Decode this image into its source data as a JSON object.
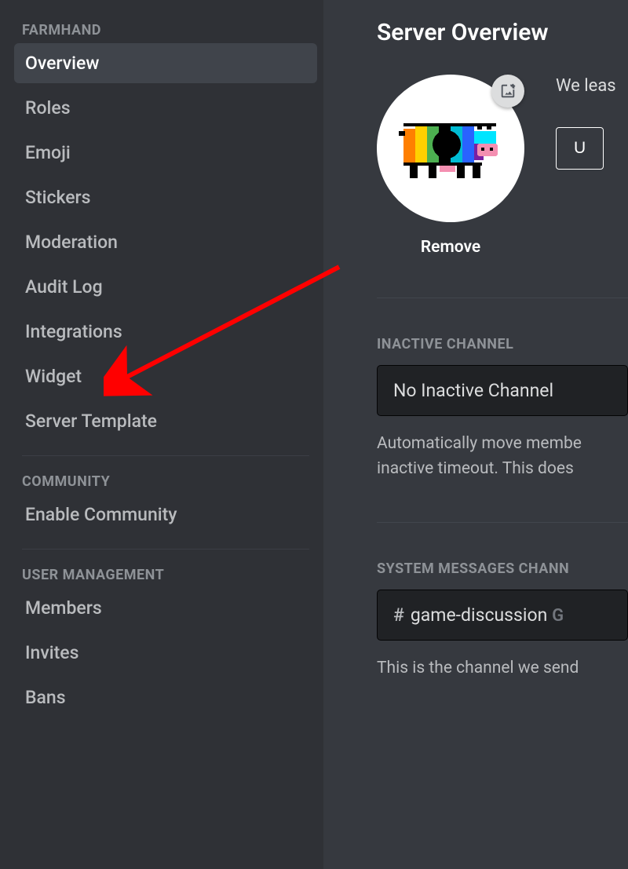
{
  "sidebar": {
    "sections": [
      {
        "header": "FARMHAND",
        "items": [
          {
            "label": "Overview",
            "selected": true
          },
          {
            "label": "Roles",
            "selected": false
          },
          {
            "label": "Emoji",
            "selected": false
          },
          {
            "label": "Stickers",
            "selected": false
          },
          {
            "label": "Moderation",
            "selected": false
          },
          {
            "label": "Audit Log",
            "selected": false
          },
          {
            "label": "Integrations",
            "selected": false
          },
          {
            "label": "Widget",
            "selected": false
          },
          {
            "label": "Server Template",
            "selected": false
          }
        ]
      },
      {
        "header": "COMMUNITY",
        "items": [
          {
            "label": "Enable Community",
            "selected": false
          }
        ]
      },
      {
        "header": "USER MANAGEMENT",
        "items": [
          {
            "label": "Members",
            "selected": false
          },
          {
            "label": "Invites",
            "selected": false
          },
          {
            "label": "Bans",
            "selected": false
          }
        ]
      }
    ]
  },
  "main": {
    "title": "Server Overview",
    "avatar": {
      "remove_label": "Remove",
      "hint": "We leas",
      "upload_button": "U"
    },
    "inactive": {
      "label": "INACTIVE CHANNEL",
      "value": "No Inactive Channel",
      "helper": "Automatically move membe inactive timeout. This does"
    },
    "system": {
      "label": "SYSTEM MESSAGES CHANN",
      "channel_name": "game-discussion",
      "channel_tail": "G",
      "helper": "This is the channel we send"
    }
  }
}
